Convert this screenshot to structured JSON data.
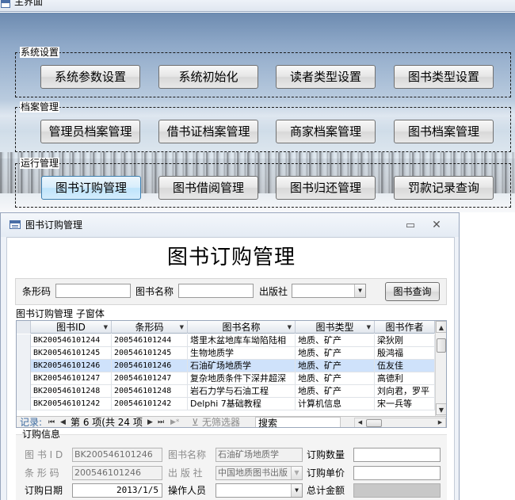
{
  "main_window": {
    "title": "主界面",
    "groups": [
      {
        "label": "系统设置",
        "buttons": [
          "系统参数设置",
          "系统初始化",
          "读者类型设置",
          "图书类型设置"
        ]
      },
      {
        "label": "档案管理",
        "buttons": [
          "管理员档案管理",
          "借书证档案管理",
          "商家档案管理",
          "图书档案管理"
        ]
      },
      {
        "label": "运行管理",
        "buttons": [
          "图书订购管理",
          "图书借阅管理",
          "图书归还管理",
          "罚款记录查询"
        ]
      }
    ]
  },
  "order_window": {
    "title": "图书订购管理",
    "minimize_icon": "minimize-icon",
    "close_icon": "close-icon",
    "heading": "图书订购管理",
    "search": {
      "barcode_label": "条形码",
      "barcode_value": "",
      "book_name_label": "图书名称",
      "book_name_value": "",
      "publisher_label": "出版社",
      "publisher_value": "",
      "button": "图书查询"
    },
    "subform_label": "图书订购管理 子窗体",
    "table": {
      "columns": [
        "图书ID",
        "条形码",
        "图书名称",
        "图书类型",
        "图书作者"
      ],
      "rows": [
        [
          "BK200546101244",
          "200546101244",
          "塔里木盆地库车坳陷陆相",
          "地质、矿产",
          "梁狄刚"
        ],
        [
          "BK200546101245",
          "200546101245",
          "生物地质学",
          "地质、矿产",
          "殷鸿福"
        ],
        [
          "BK200546101246",
          "200546101246",
          "石油矿场地质学",
          "地质、矿产",
          "伍友佳"
        ],
        [
          "BK200546101247",
          "200546101247",
          "复杂地质条件下深井超深",
          "地质、矿产",
          "高德利"
        ],
        [
          "BK200546101248",
          "200546101248",
          "岩石力学与石油工程",
          "地质、矿产",
          "刘向君，罗平"
        ],
        [
          "BK200546101242",
          "200546101242",
          "Delphi 7基础教程",
          "计算机信息",
          "宋一兵等"
        ]
      ],
      "selected_row": 2
    },
    "navigation": {
      "record_label": "记录:",
      "first": "⏮",
      "prev": "◀",
      "position": "第 6 项(共 24 项",
      "next": "▶",
      "last": "⏭",
      "new": "▶*",
      "filter": "无筛选器",
      "search": "搜索"
    },
    "order_info": {
      "title": "订购信息",
      "book_id_label": "图 书 I D",
      "book_id_value": "BK200546101246",
      "book_name_label": "图书名称",
      "book_name_value": "石油矿场地质学",
      "quantity_label": "订购数量",
      "quantity_value": "",
      "barcode_label": "条 形 码",
      "barcode_value": "200546101246",
      "publisher_label": "出 版 社",
      "publisher_value": "中国地质图书出版",
      "price_label": "订购单价",
      "price_value": "",
      "date_label": "订购日期",
      "date_value": "2013/1/5",
      "operator_label": "操作人员",
      "operator_value": "",
      "total_label": "总计金额",
      "total_value": ""
    }
  }
}
